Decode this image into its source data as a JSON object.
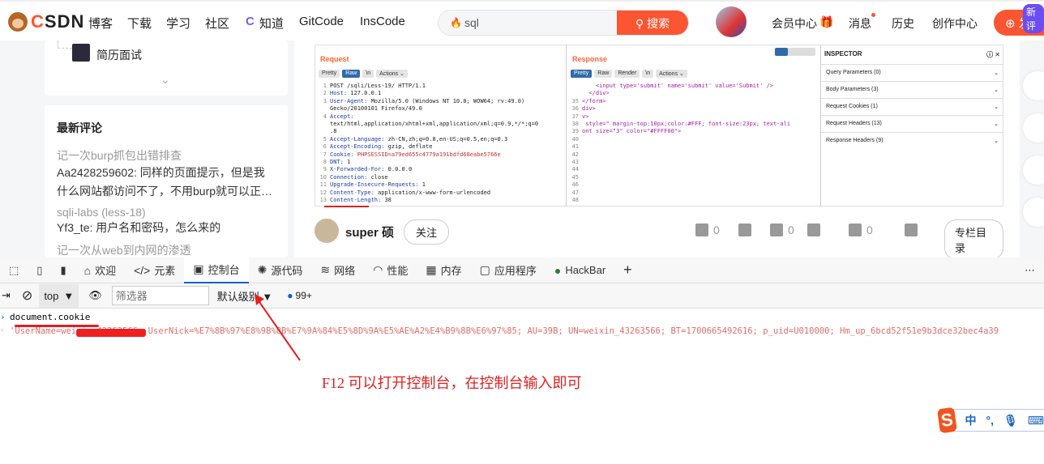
{
  "header": {
    "logo": "CSDN",
    "nav": [
      "博客",
      "下载",
      "学习",
      "社区",
      "知道",
      "GitCode",
      "InsCode"
    ],
    "search": {
      "value": "sql",
      "button": "搜索"
    },
    "right": [
      "会员中心",
      "消息",
      "历史",
      "创作中心"
    ],
    "publish": "发布",
    "new_badge": "新评"
  },
  "sidebar": {
    "column_item": "简历面试",
    "comments_title": "最新评论",
    "comments": [
      {
        "article": "记一次burp抓包出错排查",
        "text": "Aa2428259602: 同样的页面提示，但是我什么网站都访问不了，不用burp就可以正…"
      },
      {
        "article": "sqli-labs (less-18)",
        "text": "Yf3_te: 用户名和密码，怎么来的"
      },
      {
        "article": "记一次从web到内网的渗透",
        "text": ""
      }
    ]
  },
  "burp": {
    "request": {
      "title": "Request",
      "buttons": [
        "Pretty",
        "Raw",
        "\\n",
        "Actions ⌄"
      ],
      "active": "Raw",
      "lines": [
        [
          "1",
          "",
          "POST /sqli/Less-19/ HTTP/1.1"
        ],
        [
          "2",
          "Host:",
          "127.0.0.1"
        ],
        [
          "3",
          "User-Agent:",
          "Mozilla/5.0 (Windows NT 10.0; WOW64; rv:49.0)"
        ],
        [
          "",
          "",
          "Gecko/20100101 Firefox/49.0"
        ],
        [
          "4",
          "Accept:",
          ""
        ],
        [
          "",
          "",
          "text/html,application/xhtml+xml,application/xml;q=0.9,*/*;q=0"
        ],
        [
          "",
          "",
          ".8"
        ],
        [
          "5",
          "Accept-Language:",
          "zh-CN,zh;q=0.8,en-US;q=0.5,en;q=0.3"
        ],
        [
          "6",
          "Accept-Encoding:",
          "gzip, deflate"
        ],
        [
          "7",
          "Cookie:",
          "PHPSESSID=a79ed655c4779a191bdfd68eabe5766e"
        ],
        [
          "8",
          "DNT:",
          "1"
        ],
        [
          "9",
          "X-Forwarded-For:",
          "0.0.0.0"
        ],
        [
          "10",
          "Connection:",
          "close"
        ],
        [
          "11",
          "Upgrade-Insecure-Requests:",
          "1"
        ],
        [
          "12",
          "Content-Type:",
          "application/x-www-form-urlencoded"
        ],
        [
          "13",
          "Content-Length:",
          "38"
        ]
      ]
    },
    "response": {
      "title": "Response",
      "buttons": [
        "Pretty",
        "Raw",
        "Render",
        "\\n",
        "Actions ⌄"
      ],
      "active": "Pretty",
      "lines": [
        [
          "",
          "    <input type='submit' name='submit' value='Submit' />"
        ],
        [
          "",
          "  </div>"
        ],
        [
          "35",
          "</form>"
        ],
        [
          "36",
          "div>"
        ],
        [
          "37",
          "v>"
        ],
        [
          "38",
          " style=\" margin-top:10px;color:#FFF; font-size:23px; text-ali"
        ],
        [
          "39",
          "ont size=\"3\" color=\"#FFFF00\">"
        ],
        [
          "40",
          ""
        ],
        [
          "41",
          ""
        ],
        [
          "42",
          ""
        ],
        [
          "43",
          ""
        ],
        [
          "44",
          ""
        ],
        [
          "45",
          ""
        ],
        [
          "46",
          ""
        ],
        [
          "47",
          ""
        ],
        [
          "48",
          ""
        ]
      ]
    },
    "inspector": {
      "title": "INSPECTOR",
      "rows": [
        "Query Parameters (0)",
        "Body Parameters (3)",
        "Request Cookies (1)",
        "Request Headers (13)",
        "Response Headers (9)"
      ]
    }
  },
  "author": {
    "name": "super 硕",
    "follow": "关注",
    "likes": "0",
    "favorites": "0",
    "comments": "0",
    "toc": "专栏目录"
  },
  "devtools": {
    "tabs": [
      "欢迎",
      "元素",
      "控制台",
      "源代码",
      "网络",
      "性能",
      "内存",
      "应用程序",
      "HackBar"
    ],
    "active": "控制台",
    "context": "top",
    "filter_placeholder": "筛选器",
    "level": "默认级别",
    "issues": "99+"
  },
  "console": {
    "input": "document.cookie",
    "output": "'UserName=weixin_43263566; UserNick=%E7%8B%97%E8%9B%8B%E7%9A%84%E5%8D%9A%E5%AE%A2%E4%B9%8B%E6%97%85; AU=39B; UN=weixin_43263566; BT=1700665492616; p_uid=U010000; Hm_up_6bcd52f51e9b3dce32bec4a39"
  },
  "annotation": {
    "text": "F12 可以打开控制台，在控制台输入即可",
    "color": "#e02020"
  },
  "ime": {
    "mode": "中",
    "punct": "°,"
  },
  "colors": {
    "brand": "#fc5531",
    "devtools_accent": "#0b62c4"
  }
}
